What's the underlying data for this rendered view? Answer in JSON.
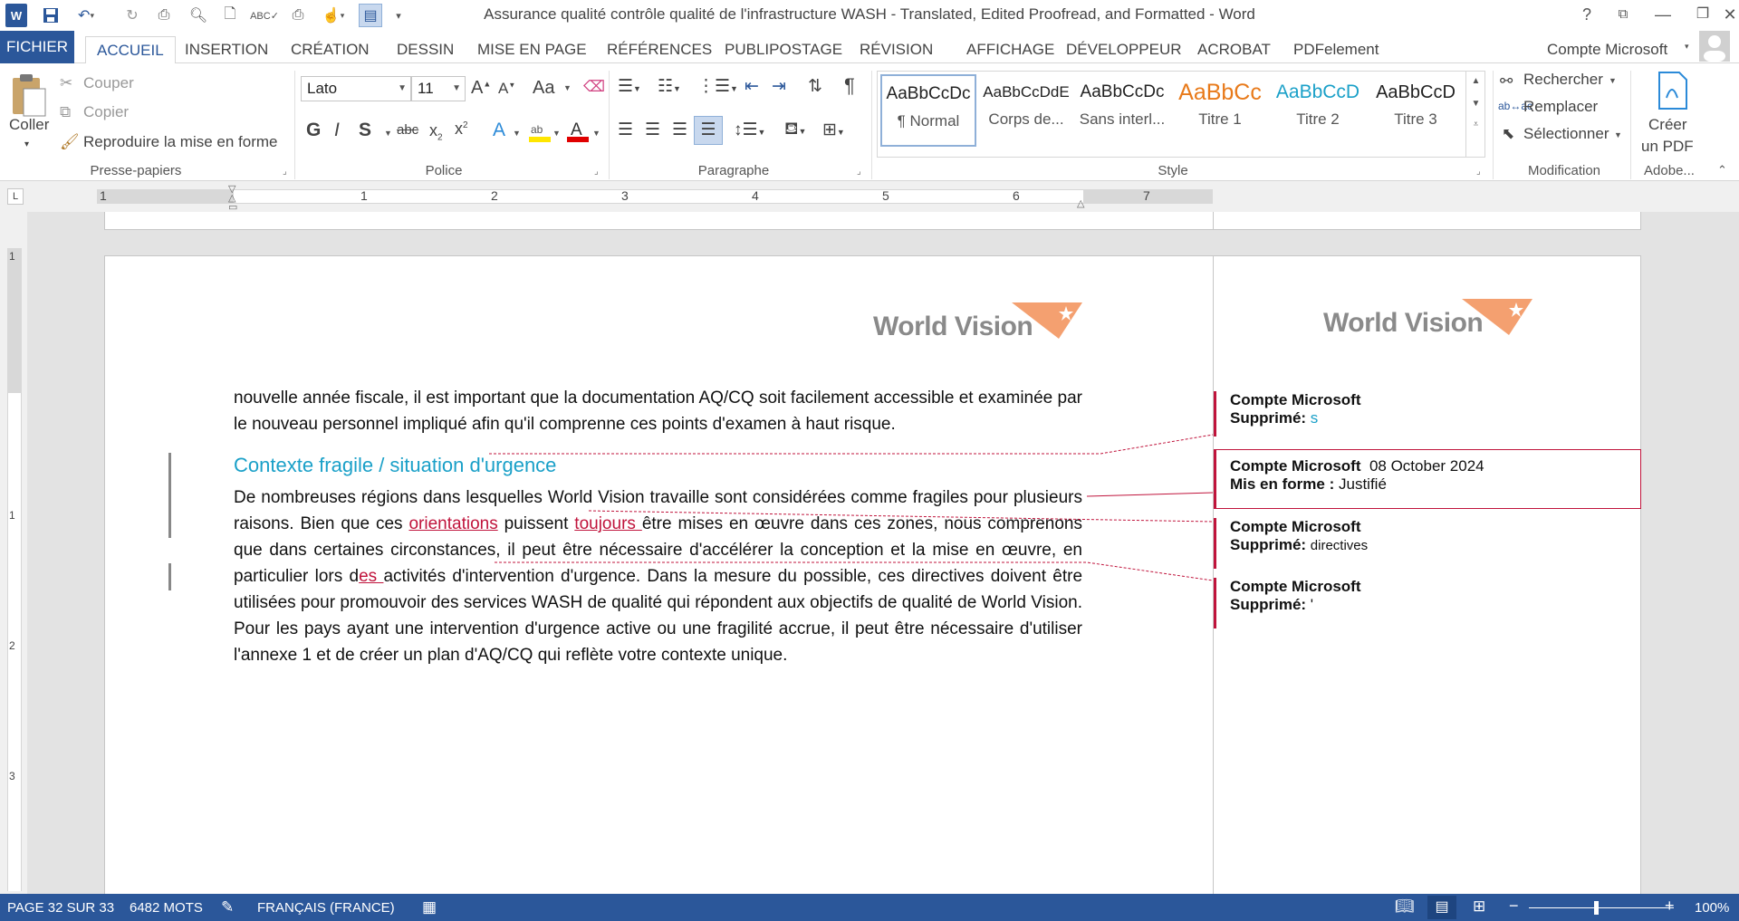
{
  "titlebar": {
    "title": "Assurance qualité  contrôle qualité de l'infrastructure WASH - Translated, Edited Proofread, and Formatted - Word",
    "help": "?"
  },
  "tabs": [
    "FICHIER",
    "ACCUEIL",
    "INSERTION",
    "CRÉATION",
    "DESSIN",
    "MISE EN PAGE",
    "RÉFÉRENCES",
    "PUBLIPOSTAGE",
    "RÉVISION",
    "AFFICHAGE",
    "DÉVELOPPEUR",
    "ACROBAT",
    "PDFelement"
  ],
  "account": "Compte Microsoft",
  "ribbon": {
    "clipboard": {
      "paste": "Coller",
      "cut": "Couper",
      "copy": "Copier",
      "format_painter": "Reproduire la mise en forme",
      "label": "Presse-papiers"
    },
    "font": {
      "name": "Lato",
      "size": "11",
      "bold": "G",
      "italic": "I",
      "underline": "S",
      "strike": "abc",
      "change_case": "Aa",
      "label": "Police"
    },
    "paragraph": {
      "label": "Paragraphe"
    },
    "styles": {
      "items": [
        {
          "preview": "AaBbCcDc",
          "name": "¶ Normal"
        },
        {
          "preview": "AaBbCcDdE",
          "name": "Corps de..."
        },
        {
          "preview": "AaBbCcDc",
          "name": "Sans interl..."
        },
        {
          "preview": "AaBbCc",
          "name": "Titre 1"
        },
        {
          "preview": "AaBbCcD",
          "name": "Titre 2"
        },
        {
          "preview": "AaBbCcD",
          "name": "Titre 3"
        }
      ],
      "label": "Style"
    },
    "editing": {
      "find": "Rechercher",
      "replace": "Remplacer",
      "select": "Sélectionner",
      "label": "Modification"
    },
    "adobe": {
      "create_pdf_1": "Créer",
      "create_pdf_2": "un PDF",
      "label": "Adobe..."
    }
  },
  "ruler": {
    "numbers": [
      "1",
      "1",
      "2",
      "3",
      "4",
      "5",
      "6",
      "7"
    ]
  },
  "vruler": {
    "numbers": [
      "1",
      "1",
      "2",
      "3"
    ]
  },
  "document": {
    "logo": "World Vision",
    "para1": "nouvelle année fiscale, il est important que la documentation AQ/CQ soit facilement accessible et examinée par le nouveau personnel impliqué afin qu'il comprenne ces points d'examen à haut risque.",
    "heading": "Contexte fragile / situation d'urgence",
    "para2_a": "De nombreuses régions dans lesquelles World Vision travaille sont considérées comme fragiles pour plusieurs raisons. Bien que ces ",
    "para2_ins1": "orientations",
    "para2_b": " puissent ",
    "para2_ins2": "toujours ",
    "para2_c": "être mises en œuvre dans ces zones, nous comprenons que dans certaines circonstances, il peut être nécessaire d'accélérer la conception et la mise en œuvre, en particulier lors d",
    "para2_ins3": "es ",
    "para2_d": "activités d'intervention d'urgence. Dans la mesure du possible, ces directives doivent être utilisées pour promouvoir des services WASH de qualité qui répondent aux objectifs de qualité de World Vision. Pour les pays ayant une intervention d'urgence active ou une fragilité accrue, il peut être nécessaire d'utiliser l'annexe 1 et de créer un plan d'AQ/CQ qui reflète votre contexte unique."
  },
  "comments": [
    {
      "author": "Compte Microsoft",
      "date": "",
      "label": "Supprimé:",
      "value": "s"
    },
    {
      "author": "Compte Microsoft",
      "date": "08 October 2024",
      "label": "Mis en forme :",
      "value": "Justifié"
    },
    {
      "author": "Compte Microsoft",
      "date": "",
      "label": "Supprimé:",
      "value": "directives"
    },
    {
      "author": "Compte Microsoft",
      "date": "",
      "label": "Supprimé:",
      "value": "'"
    }
  ],
  "status": {
    "page": "PAGE 32 SUR 33",
    "words": "6482 MOTS",
    "language": "FRANÇAIS (FRANCE)",
    "zoom": "100%"
  },
  "colors": {
    "brand": "#2b579a",
    "revision": "#c0143c",
    "heading": "#1aa0c8",
    "logo_accent": "#f4a070"
  }
}
